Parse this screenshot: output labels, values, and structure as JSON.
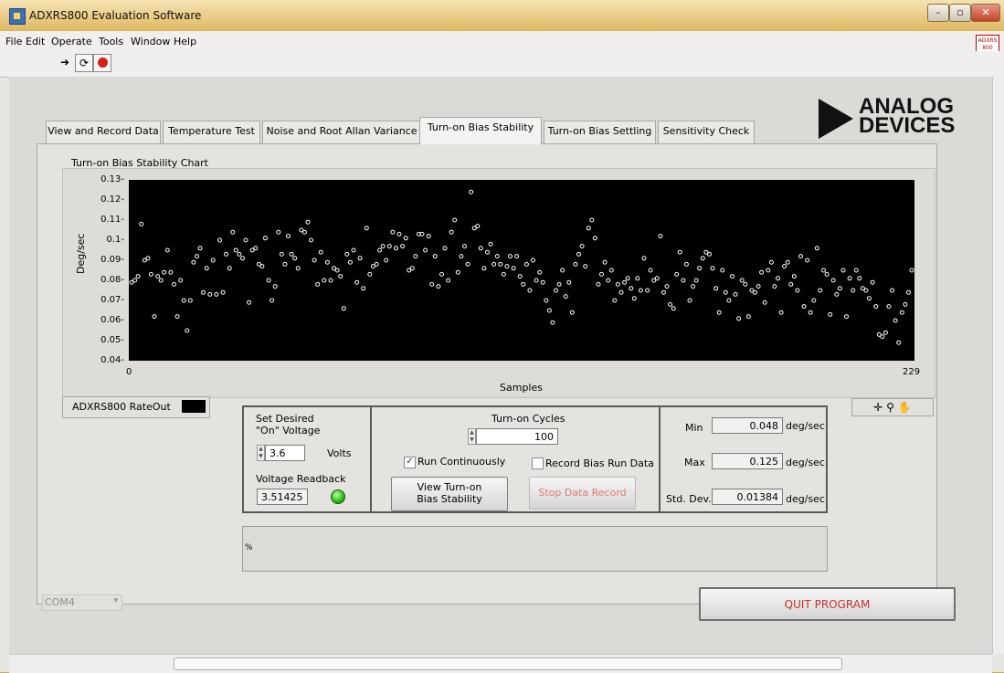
{
  "window": {
    "title": "ADXRS800 Evaluation Software"
  },
  "menu": [
    "File",
    "Edit",
    "Operate",
    "Tools",
    "Window",
    "Help"
  ],
  "badge": "ADXRS 800 EVAL",
  "logo": {
    "line1": "ANALOG",
    "line2": "DEVICES"
  },
  "tabs": [
    "View and Record Data",
    "Temperature Test",
    "Noise and Root Allan Variance",
    "Turn-on Bias Stability",
    "Turn-on Bias Settling",
    "Sensitivity Check"
  ],
  "active_tab": "Turn-on Bias Stability",
  "chart": {
    "title": "Turn-on Bias Stability Chart",
    "legend": "ADXRS800 RateOut"
  },
  "chart_data": {
    "type": "scatter",
    "title": "Turn-on Bias Stability Chart",
    "xlabel": "Samples",
    "ylabel": "Deg/sec",
    "xlim": [
      0,
      229
    ],
    "ylim": [
      0.04,
      0.13
    ],
    "yticks": [
      "0.13",
      "0.12",
      "0.11",
      "0.1",
      "0.09",
      "0.08",
      "0.07",
      "0.06",
      "0.05",
      "0.04"
    ],
    "xticks": [
      "0",
      "229"
    ],
    "grid": false,
    "legend_position": "bottom-left",
    "series": [
      {
        "name": "ADXRS800 RateOut",
        "color": "#ffffff",
        "y": [
          0.079,
          0.08,
          0.082,
          0.108,
          0.09,
          0.091,
          0.083,
          0.062,
          0.082,
          0.08,
          0.084,
          0.095,
          0.084,
          0.078,
          0.062,
          0.08,
          0.07,
          0.055,
          0.07,
          0.089,
          0.092,
          0.096,
          0.074,
          0.086,
          0.073,
          0.09,
          0.073,
          0.1,
          0.074,
          0.093,
          0.086,
          0.104,
          0.095,
          0.093,
          0.091,
          0.1,
          0.069,
          0.095,
          0.096,
          0.088,
          0.087,
          0.101,
          0.08,
          0.07,
          0.077,
          0.104,
          0.093,
          0.088,
          0.102,
          0.093,
          0.091,
          0.086,
          0.105,
          0.104,
          0.109,
          0.1,
          0.09,
          0.078,
          0.094,
          0.08,
          0.089,
          0.08,
          0.086,
          0.085,
          0.082,
          0.066,
          0.093,
          0.089,
          0.095,
          0.079,
          0.091,
          0.076,
          0.106,
          0.083,
          0.087,
          0.088,
          0.095,
          0.097,
          0.09,
          0.097,
          0.104,
          0.096,
          0.103,
          0.097,
          0.101,
          0.085,
          0.086,
          0.092,
          0.103,
          0.103,
          0.095,
          0.102,
          0.078,
          0.092,
          0.077,
          0.083,
          0.096,
          0.08,
          0.104,
          0.11,
          0.084,
          0.092,
          0.097,
          0.088,
          0.124,
          0.106,
          0.107,
          0.096,
          0.086,
          0.094,
          0.098,
          0.088,
          0.092,
          0.088,
          0.083,
          0.087,
          0.092,
          0.086,
          0.092,
          0.082,
          0.078,
          0.088,
          0.075,
          0.09,
          0.08,
          0.084,
          0.079,
          0.07,
          0.065,
          0.059,
          0.075,
          0.078,
          0.085,
          0.072,
          0.079,
          0.064,
          0.088,
          0.093,
          0.097,
          0.087,
          0.106,
          0.11,
          0.101,
          0.078,
          0.083,
          0.089,
          0.08,
          0.085,
          0.07,
          0.078,
          0.074,
          0.079,
          0.081,
          0.076,
          0.071,
          0.081,
          0.075,
          0.091,
          0.075,
          0.085,
          0.08,
          0.081,
          0.102,
          0.074,
          0.077,
          0.068,
          0.066,
          0.083,
          0.094,
          0.08,
          0.088,
          0.07,
          0.077,
          0.08,
          0.086,
          0.091,
          0.094,
          0.093,
          0.086,
          0.076,
          0.064,
          0.085,
          0.074,
          0.07,
          0.082,
          0.073,
          0.061,
          0.08,
          0.078,
          0.062,
          0.075,
          0.074,
          0.077,
          0.084,
          0.069,
          0.085,
          0.089,
          0.077,
          0.081,
          0.064,
          0.087,
          0.089,
          0.078,
          0.082,
          0.075,
          0.092,
          0.067,
          0.09,
          0.064,
          0.07,
          0.096,
          0.075,
          0.085,
          0.083,
          0.063,
          0.08,
          0.073,
          0.076,
          0.085,
          0.062,
          0.081,
          0.075,
          0.085,
          0.081,
          0.076,
          0.075,
          0.071,
          0.079,
          0.067,
          0.053,
          0.052,
          0.054,
          0.067,
          0.075,
          0.06,
          0.049,
          0.064,
          0.068,
          0.074,
          0.085
        ]
      }
    ]
  },
  "voltage": {
    "set_label": "Set Desired \"On\" Voltage",
    "set_value": "3.6",
    "unit": "Volts",
    "readback_label": "Voltage Readback",
    "readback_value": "3.51425"
  },
  "cycles": {
    "label": "Turn-on Cycles",
    "value": "100",
    "run_continuously": "Run Continuously",
    "run_checked": true,
    "record_bias": "Record Bias Run Data",
    "record_checked": false,
    "view_button": "View Turn-on Bias Stability",
    "stop_button": "Stop Data Record"
  },
  "stats": {
    "min_label": "Min",
    "min_value": "0.048",
    "max_label": "Max",
    "max_value": "0.125",
    "std_label": "Std. Dev.",
    "std_value": "0.01384",
    "unit": "deg/sec"
  },
  "com_port": "COM4",
  "quit_button": "QUIT PROGRAM",
  "colors": {
    "plot_bg": "#000000",
    "marker": "#ffffff",
    "quit_text": "#c8332b",
    "stop_text": "#e07b73",
    "led": "#2dc21c"
  }
}
